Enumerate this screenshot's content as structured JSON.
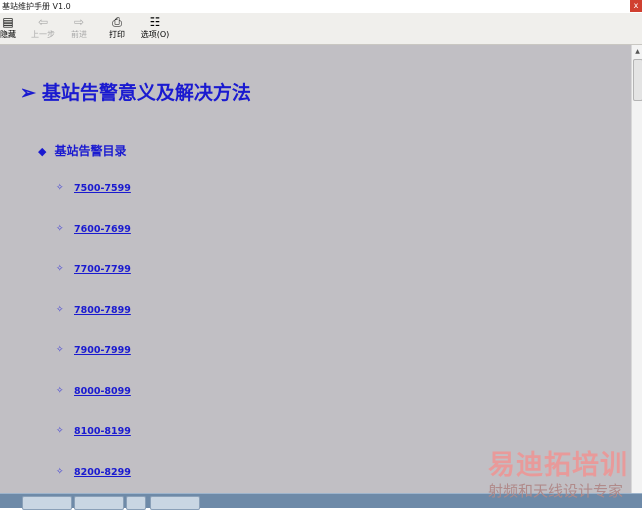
{
  "window": {
    "title": "基站维护手册 V1.0",
    "close_glyph": "x"
  },
  "toolbar": {
    "buttons": [
      {
        "icon": "contents-icon",
        "glyph": "▤",
        "label": "隐藏",
        "enabled": true
      },
      {
        "icon": "back-arrow-icon",
        "glyph": "⇦",
        "label": "上一步",
        "enabled": false
      },
      {
        "icon": "forward-arrow-icon",
        "glyph": "⇨",
        "label": "前进",
        "enabled": false
      },
      {
        "icon": "printer-icon",
        "glyph": "⎙",
        "label": "打印",
        "enabled": true
      },
      {
        "icon": "options-icon",
        "glyph": "☷",
        "label": "选项(O)",
        "enabled": true
      }
    ]
  },
  "content": {
    "heading_arrow": "➢",
    "heading": "基站告警意义及解决方法",
    "sub_bullet": "◆",
    "sub_heading": "基站告警目录",
    "item_bullet": "✧",
    "ranges": [
      "7500-7599",
      "7600-7699",
      "7700-7799",
      "7800-7899",
      "7900-7999",
      "8000-8099",
      "8100-8199",
      "8200-8299"
    ]
  },
  "watermark": {
    "logo": "易迪拓培训",
    "tagline": "射频和天线设计专家"
  },
  "colors": {
    "content_bg": "#c1bfc4",
    "link": "#1a1ad0",
    "toolbar_bg": "#f0efec"
  }
}
